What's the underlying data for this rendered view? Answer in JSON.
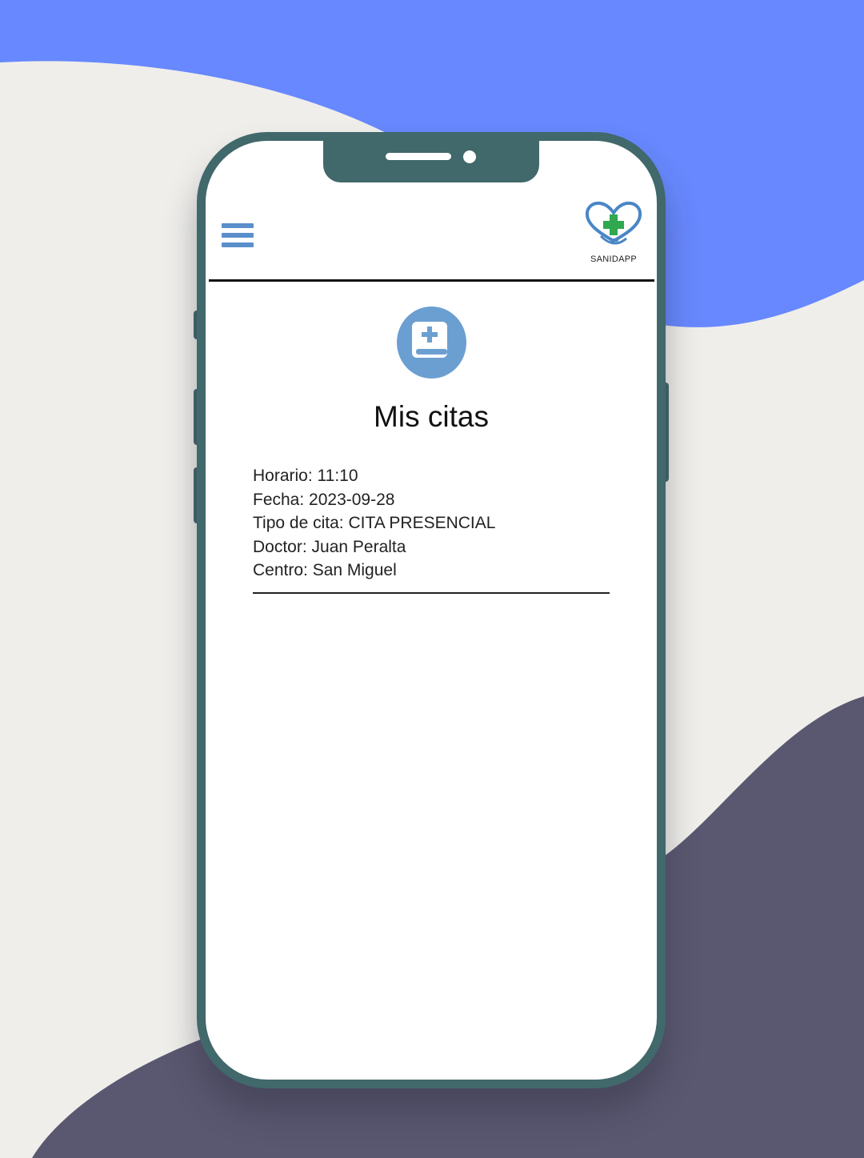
{
  "header": {
    "brand": "SANIDAPP"
  },
  "page": {
    "title": "Mis citas"
  },
  "appointment": {
    "horario": "Horario: 11:10",
    "fecha": "Fecha: 2023-09-28",
    "tipo": "Tipo de cita: CITA PRESENCIAL",
    "doctor": "Doctor: Juan Peralta",
    "centro": "Centro: San Miguel"
  },
  "icons": {
    "menu": "hamburger-menu-icon",
    "logo": "heart-cross-logo-icon",
    "page": "medical-book-icon"
  },
  "colors": {
    "accent": "#5b8fcc",
    "icon_circle": "#6c9fd1",
    "phone_frame": "#41686b",
    "background_blue": "#6788fe",
    "background_dark": "#5a5870",
    "background_light": "#efeeea",
    "logo_cross": "#2fa84f"
  }
}
